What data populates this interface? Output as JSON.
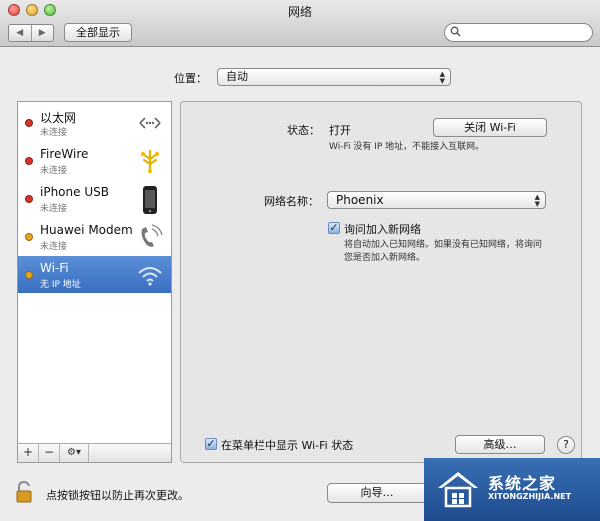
{
  "window": {
    "title": "网络",
    "show_all_label": "全部显示",
    "search_placeholder": ""
  },
  "location": {
    "label": "位置：",
    "value": "自动"
  },
  "sidebar": {
    "items": [
      {
        "name": "以太网",
        "status": "未连接",
        "status_color": "#d8322c",
        "icon": "ethernet-icon",
        "selected": false
      },
      {
        "name": "FireWire",
        "status": "未连接",
        "status_color": "#d8322c",
        "icon": "firewire-icon",
        "selected": false
      },
      {
        "name": "iPhone USB",
        "status": "未连接",
        "status_color": "#d8322c",
        "icon": "iphone-icon",
        "selected": false
      },
      {
        "name": "Huawei Modem",
        "status": "未连接",
        "status_color": "#e8a51f",
        "icon": "modem-icon",
        "selected": false
      },
      {
        "name": "Wi-Fi",
        "status": "无 IP 地址",
        "status_color": "#e8a51f",
        "icon": "wifi-icon",
        "selected": true
      }
    ],
    "add_label": "+",
    "remove_label": "−",
    "gear_label": "⚙▾"
  },
  "panel": {
    "status_label": "状态：",
    "status_value": "打开",
    "wifi_off_button": "关闭 Wi-Fi",
    "status_desc": "Wi-Fi 没有 IP 地址，不能接入互联网。",
    "network_name_label": "网络名称：",
    "network_name_value": "Phoenix",
    "ask_join_label": "询问加入新网络",
    "ask_join_checked": true,
    "ask_join_desc_1": "将自动加入已知网络。如果没有已知网络，将询问",
    "ask_join_desc_2": "您是否加入新网络。",
    "show_menubar_label": "在菜单栏中显示 Wi-Fi 状态",
    "show_menubar_checked": true,
    "advanced_button": "高级…",
    "help_label": "?"
  },
  "footer": {
    "lock_text": "点按锁按钮以防止再次更改。",
    "assistant_button": "向导…"
  },
  "watermark": {
    "title": "系统之家",
    "url": "XITONGZHIJIA.NET"
  }
}
